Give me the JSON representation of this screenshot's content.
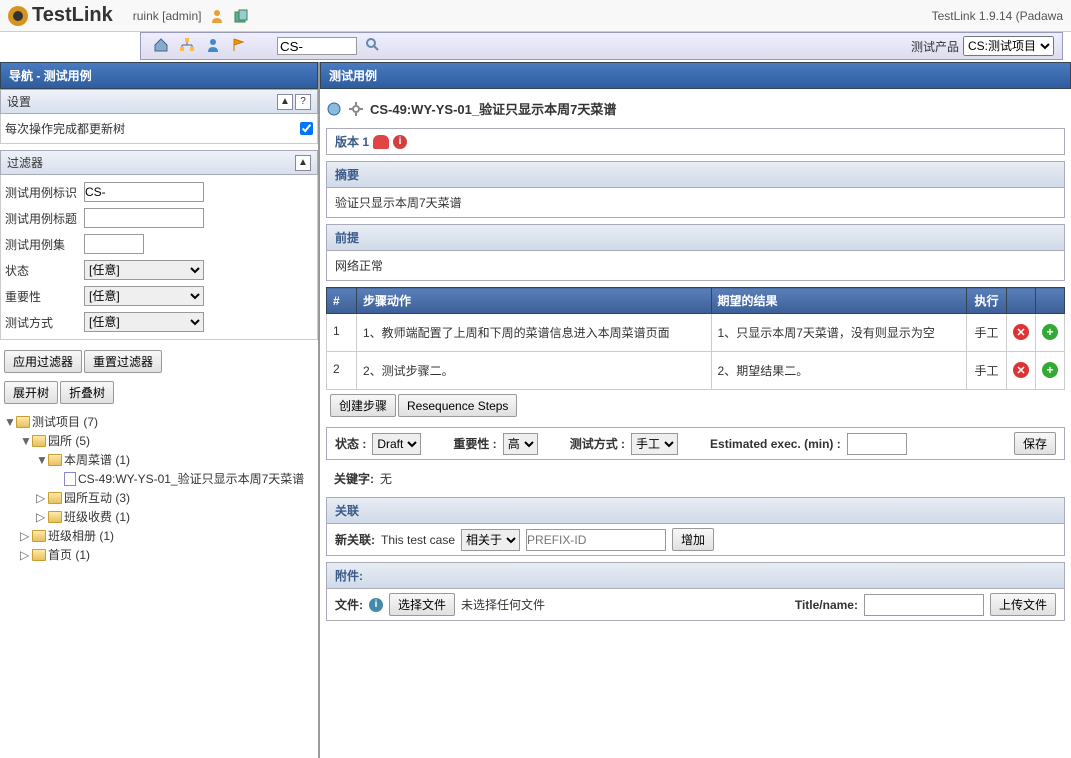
{
  "app": {
    "name": "TestLink",
    "version": "TestLink 1.9.14 (Padawa"
  },
  "user": {
    "name": "ruink [admin]"
  },
  "toolbar": {
    "search_value": "CS-",
    "product_label": "测试产品",
    "product_selected": "CS:测试项目"
  },
  "left": {
    "nav_title": "导航 - 测试用例",
    "settings_title": "设置",
    "update_tree_label": "每次操作完成都更新树",
    "filter_title": "过滤器",
    "filter_tc_id_label": "测试用例标识",
    "filter_tc_id_value": "CS-",
    "filter_title_label": "测试用例标题",
    "filter_set_label": "测试用例集",
    "filter_status_label": "状态",
    "filter_importance_label": "重要性",
    "filter_exec_label": "测试方式",
    "filter_any": "[任意]",
    "apply_filter_btn": "应用过滤器",
    "reset_filter_btn": "重置过滤器",
    "expand_btn": "展开树",
    "collapse_btn": "折叠树",
    "tree": {
      "root": "测试项目 (7)",
      "n1": "园所 (5)",
      "n1_1": "本周菜谱 (1)",
      "n1_1_1": "CS-49:WY-YS-01_验证只显示本周7天菜谱",
      "n1_2": "园所互动 (3)",
      "n1_3": "班级收费 (1)",
      "n2": "班级相册 (1)",
      "n3": "首页 (1)"
    }
  },
  "right": {
    "panel_title": "测试用例",
    "tc_title": "CS-49:WY-YS-01_验证只显示本周7天菜谱",
    "version_label": "版本 1",
    "summary_title": "摘要",
    "summary_body": "验证只显示本周7天菜谱",
    "precondition_title": "前提",
    "precondition_body": "网络正常",
    "steps": {
      "col_num": "#",
      "col_action": "步骤动作",
      "col_expected": "期望的结果",
      "col_exec": "执行",
      "rows": [
        {
          "num": "1",
          "action": "1、教师端配置了上周和下周的菜谱信息进入本周菜谱页面",
          "expected": "1、只显示本周7天菜谱，没有则显示为空",
          "exec": "手工"
        },
        {
          "num": "2",
          "action": "2、测试步骤二。",
          "expected": "2、期望结果二。",
          "exec": "手工"
        }
      ]
    },
    "create_step_btn": "创建步骤",
    "resequence_btn": "Resequence Steps",
    "status_label": "状态 :",
    "status_value": "Draft",
    "importance_label": "重要性 :",
    "importance_value": "高",
    "exec_label": "测试方式 :",
    "exec_value": "手工",
    "est_label": "Estimated exec. (min) :",
    "save_btn": "保存",
    "keyword_label": "关键字:",
    "keyword_value": "无",
    "relation_title": "关联",
    "new_relation_label": "新关联:",
    "new_relation_text": "This test case",
    "relation_type": "相关于",
    "relation_placeholder": "PREFIX-ID",
    "add_btn": "增加",
    "attachment_title": "附件:",
    "file_label": "文件:",
    "choose_file_btn": "选择文件",
    "no_file_text": "未选择任何文件",
    "title_name_label": "Title/name:",
    "upload_btn": "上传文件"
  }
}
